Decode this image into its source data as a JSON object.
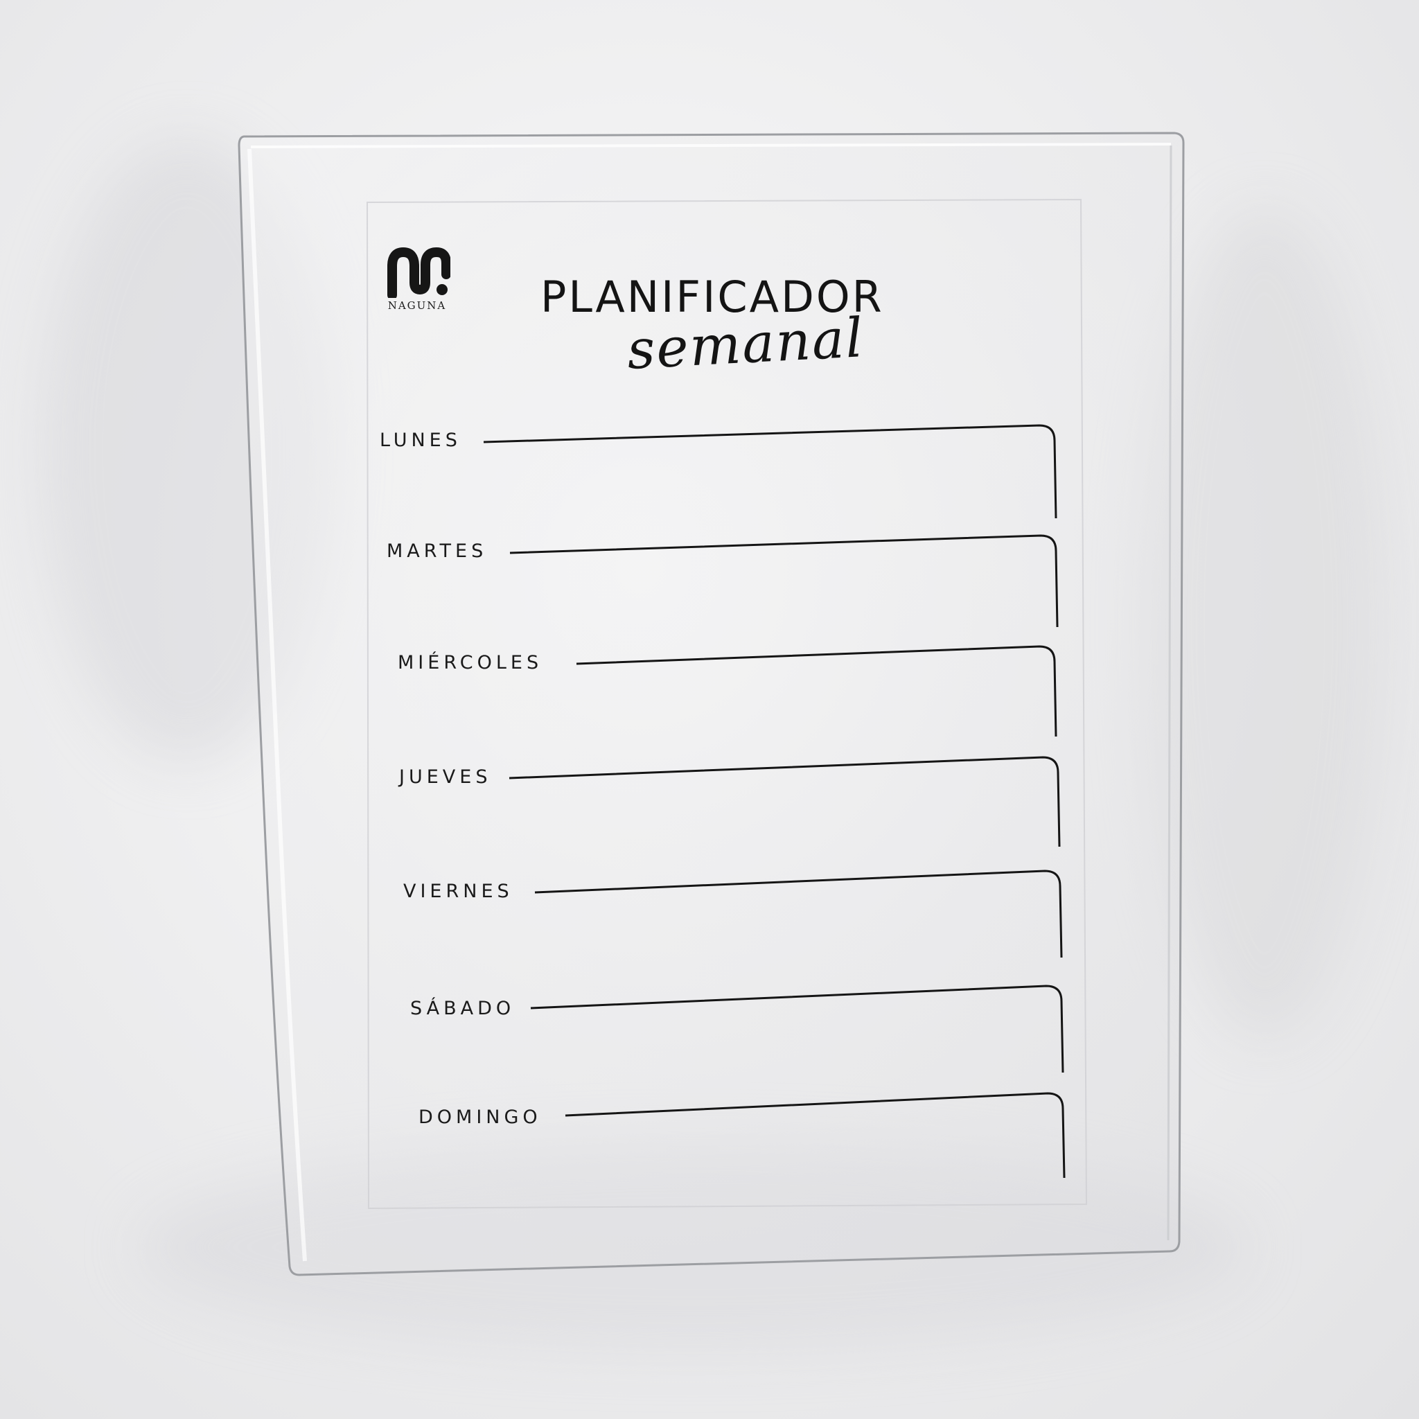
{
  "brand": {
    "name": "NAGUNA",
    "logo_icon": "naguna-logo-icon"
  },
  "planner": {
    "title": "PLANIFICADOR",
    "subtitle": "semanal",
    "days": [
      "LUNES",
      "MARTES",
      "MIÉRCOLES",
      "JUEVES",
      "VIERNES",
      "SÁBADO",
      "DOMINGO"
    ]
  },
  "colors": {
    "background": "#ececee",
    "ink": "#141414"
  }
}
